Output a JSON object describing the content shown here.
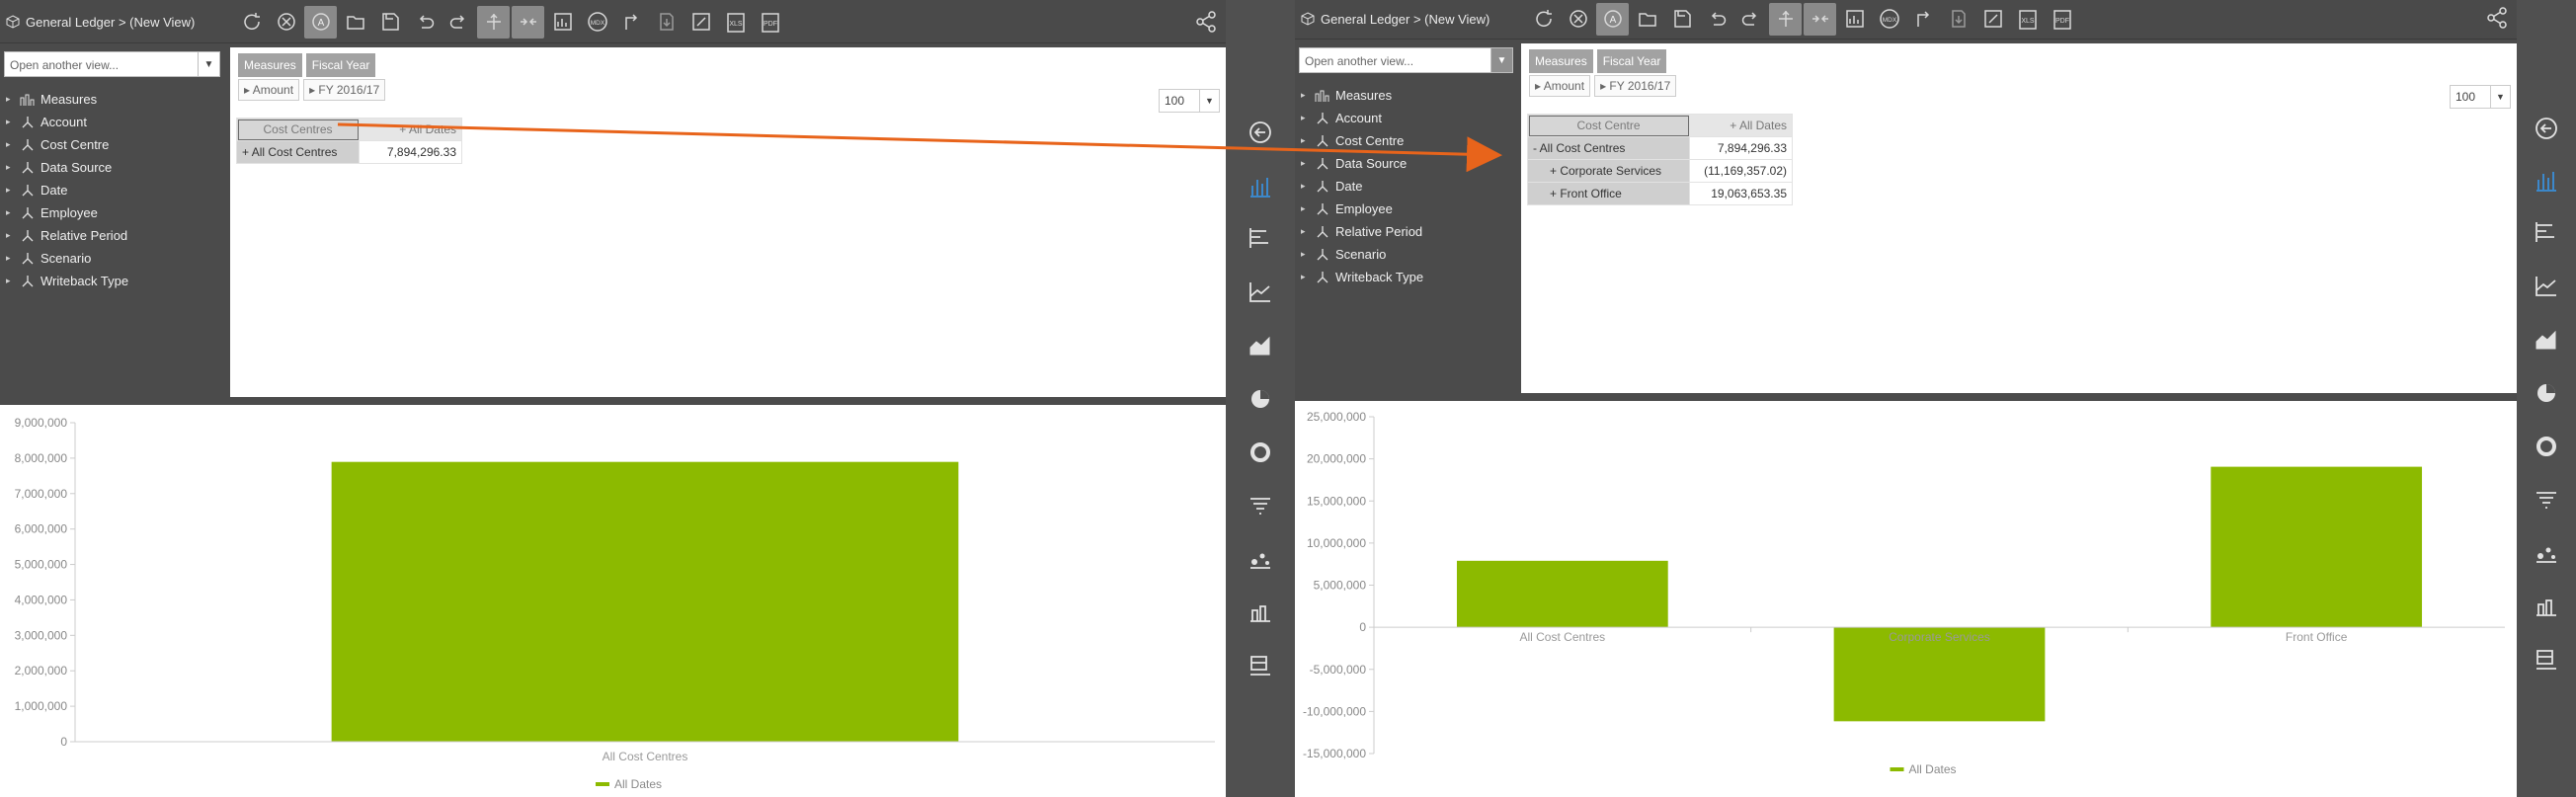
{
  "left": {
    "breadcrumb": "General Ledger > (New View)",
    "view_placeholder": "Open another view...",
    "tree": [
      "Measures",
      "Account",
      "Cost Centre",
      "Data Source",
      "Date",
      "Employee",
      "Relative Period",
      "Scenario",
      "Writeback Type"
    ],
    "chips": {
      "measures": "Measures",
      "fiscal_year": "Fiscal Year",
      "amount": "Amount",
      "fy": "FY 2016/17"
    },
    "page_size": "100",
    "grid": {
      "row_header": "Cost Centres",
      "col_header": "All Dates",
      "rows": [
        {
          "label": "All Cost Centres",
          "value": "7,894,296.33"
        }
      ]
    }
  },
  "right": {
    "breadcrumb": "General Ledger > (New View)",
    "view_placeholder": "Open another view...",
    "tree": [
      "Measures",
      "Account",
      "Cost Centre",
      "Data Source",
      "Date",
      "Employee",
      "Relative Period",
      "Scenario",
      "Writeback Type"
    ],
    "chips": {
      "measures": "Measures",
      "fiscal_year": "Fiscal Year",
      "amount": "Amount",
      "fy": "FY 2016/17"
    },
    "page_size": "100",
    "grid": {
      "row_header": "Cost Centre",
      "col_header": "All Dates",
      "rows": [
        {
          "label": "All Cost Centres",
          "value": "7,894,296.33"
        },
        {
          "label": "Corporate Services",
          "value": "(11,169,357.02)"
        },
        {
          "label": "Front Office",
          "value": "19,063,653.35"
        }
      ]
    }
  },
  "chart_data": [
    {
      "type": "bar",
      "categories": [
        "All Cost Centres"
      ],
      "series": [
        {
          "name": "All Dates",
          "values": [
            7894296.33
          ]
        }
      ],
      "ylim": [
        0,
        9000000
      ],
      "yticks": [
        "0",
        "1,000,000",
        "2,000,000",
        "3,000,000",
        "4,000,000",
        "5,000,000",
        "6,000,000",
        "7,000,000",
        "8,000,000",
        "9,000,000"
      ],
      "legend": "bottom",
      "color": "#8cba00"
    },
    {
      "type": "bar",
      "categories": [
        "All Cost Centres",
        "Corporate Services",
        "Front Office"
      ],
      "series": [
        {
          "name": "All Dates",
          "values": [
            7894296.33,
            -11169357.02,
            19063653.35
          ]
        }
      ],
      "ylim": [
        -15000000,
        25000000
      ],
      "yticks": [
        "-15,000,000",
        "-10,000,000",
        "-5,000,000",
        "0",
        "5,000,000",
        "10,000,000",
        "15,000,000",
        "20,000,000",
        "25,000,000"
      ],
      "legend": "bottom",
      "color": "#8cba00"
    }
  ],
  "colors": {
    "bar": "#8cba00",
    "arrow": "#e8641b",
    "panel": "#4b4b4b",
    "active_icon": "#3a8fd9"
  },
  "rail_icons": [
    "back-icon",
    "column-chart-icon",
    "bar-chart-icon",
    "line-chart-icon",
    "area-chart-icon",
    "pie-chart-icon",
    "donut-chart-icon",
    "funnel-chart-icon",
    "scatter-chart-icon",
    "combo-chart-icon",
    "table-chart-icon"
  ],
  "toolbar_icons": [
    "refresh-icon",
    "cancel-icon",
    "auto-icon",
    "open-icon",
    "save-icon",
    "undo-icon",
    "redo-icon",
    "pivot-split-icon",
    "pivot-merge-icon",
    "chart-toggle-icon",
    "mdx-icon",
    "swap-icon",
    "export-icon",
    "write-icon",
    "xls-icon",
    "pdf-icon"
  ],
  "toolbar_labels": {
    "mdx": "MDX",
    "xls": "XLS",
    "pdf": "PDF"
  }
}
